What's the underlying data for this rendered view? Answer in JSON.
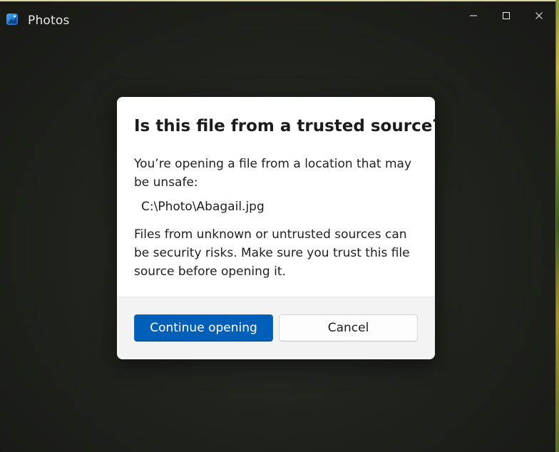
{
  "window": {
    "title": "Photos",
    "app_icon": "photos-app-icon",
    "controls": {
      "minimize_icon": "minimize-icon",
      "maximize_icon": "maximize-icon",
      "close_icon": "close-icon"
    }
  },
  "dialog": {
    "title": "Is this file from a trusted source?",
    "message_1": "You’re opening a file from a location that may be unsafe:",
    "file_path": "C:\\Photo\\Abagail.jpg",
    "message_2": "Files from unknown or untrusted sources can be security risks. Make sure you trust this file source before opening it.",
    "primary_button": "Continue opening",
    "secondary_button": "Cancel"
  },
  "colors": {
    "accent": "#005fb8",
    "dialog_background": "#ffffff",
    "footer_background": "#f3f3f3",
    "window_background": "#1c1d18"
  }
}
